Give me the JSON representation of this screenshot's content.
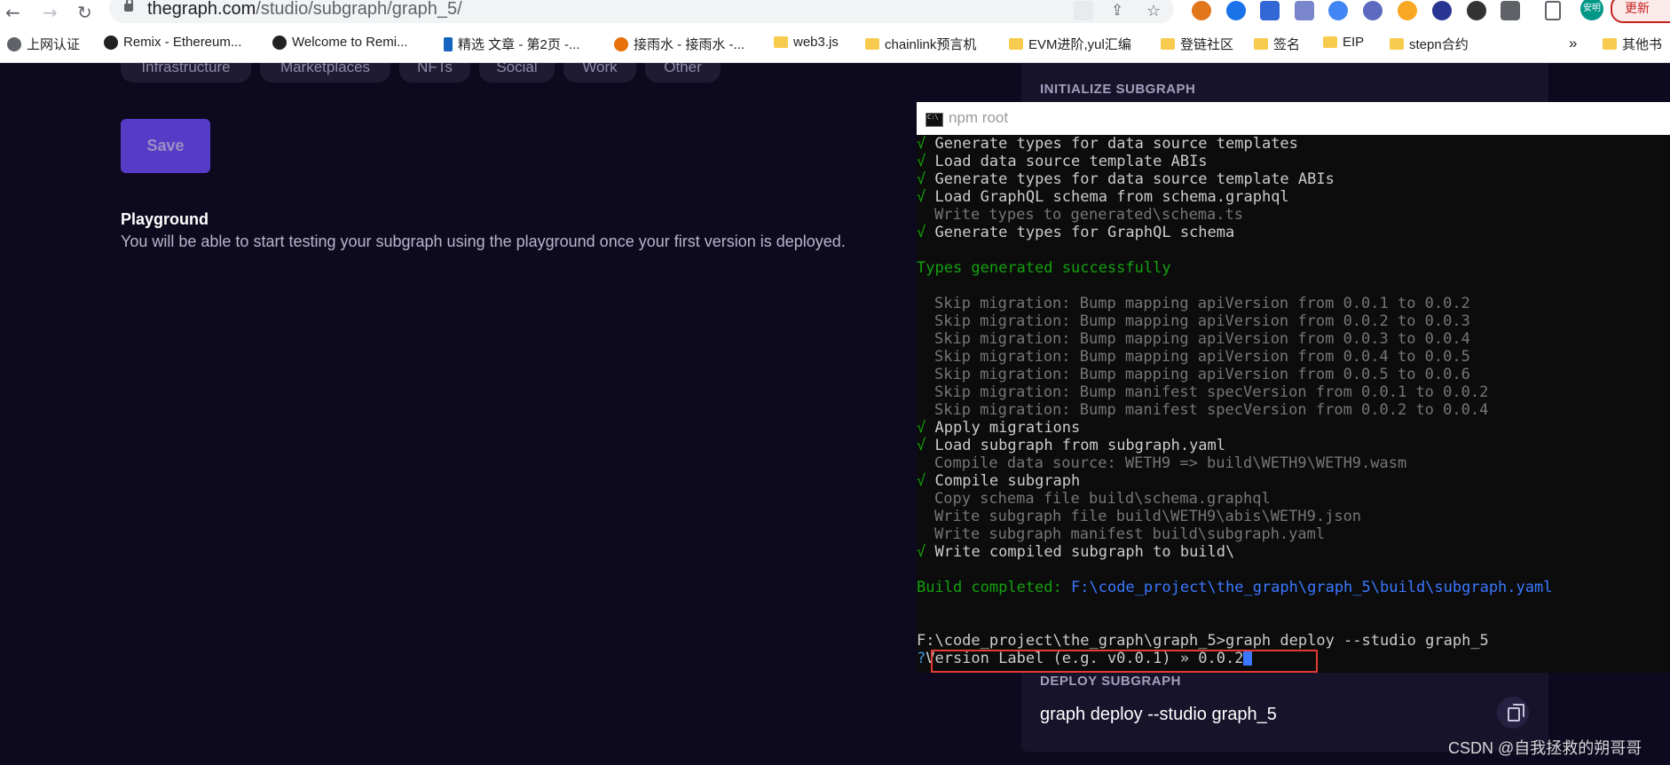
{
  "browser": {
    "url_host": "thegraph.com",
    "url_path": "/studio/subgraph/graph_5/",
    "update_label": "更新",
    "profile_label": "安明",
    "bookmarks": [
      "上网认证",
      "Remix - Ethereum...",
      "Welcome to Remi...",
      "精选 文章 - 第2页 -...",
      "接雨水 - 接雨水 -...",
      "web3.js",
      "chainlink预言机",
      "EVM进阶,yul汇编",
      "登链社区",
      "签名",
      "EIP",
      "stepn合约"
    ],
    "overflow_label": "»",
    "other_bookmarks": "其他书"
  },
  "page": {
    "categories": [
      "Infrastructure",
      "Marketplaces",
      "NFTs",
      "Social",
      "Work",
      "Other"
    ],
    "save_label": "Save",
    "playground_title": "Playground",
    "playground_desc": "You will be able to start testing your subgraph using the playground once your first version is deployed.",
    "init_label": "INITIALIZE SUBGRAPH",
    "deploy_label": "DEPLOY SUBGRAPH",
    "deploy_cmd": "graph deploy --studio graph_5"
  },
  "terminal": {
    "title": "npm root",
    "check": "√",
    "lines": {
      "l1": "Generate types for data source templates",
      "l2": "Load data source template ABIs",
      "l3": "Generate types for data source template ABIs",
      "l4": "Load GraphQL schema from schema.graphql",
      "l5": "Write types to generated\\schema.ts",
      "l6": "Generate types for GraphQL schema",
      "l7": "Types generated successfully",
      "m1": "Skip migration: Bump mapping apiVersion from 0.0.1 to 0.0.2",
      "m2": "Skip migration: Bump mapping apiVersion from 0.0.2 to 0.0.3",
      "m3": "Skip migration: Bump mapping apiVersion from 0.0.3 to 0.0.4",
      "m4": "Skip migration: Bump mapping apiVersion from 0.0.4 to 0.0.5",
      "m5": "Skip migration: Bump mapping apiVersion from 0.0.5 to 0.0.6",
      "m6": "Skip migration: Bump manifest specVersion from 0.0.1 to 0.0.2",
      "m7": "Skip migration: Bump manifest specVersion from 0.0.2 to 0.0.4",
      "a1": "Apply migrations",
      "a2": "Load subgraph from subgraph.yaml",
      "a3": "Compile data source: WETH9 => build\\WETH9\\WETH9.wasm",
      "a4": "Compile subgraph",
      "a5": "Copy schema file build\\schema.graphql",
      "a6": "Write subgraph file build\\WETH9\\abis\\WETH9.json",
      "a7": "Write subgraph manifest build\\subgraph.yaml",
      "a8": "Write compiled subgraph to build\\",
      "b1": "Build completed:",
      "b2": "F:\\code_project\\the_graph\\graph_5\\build\\subgraph.yaml",
      "c1": "F:\\code_project\\the_graph\\graph_5>graph deploy --studio graph_5",
      "q_mark": "?",
      "q_text": "Version Label (e.g. v0.0.1) » 0.0.2"
    }
  },
  "watermark": "CSDN @自我拯救的朔哥哥",
  "colors": {
    "page_bg": "#0d0a1f",
    "accent": "#6f4cff",
    "terminal_green": "#13a10e",
    "terminal_blue": "#3b78ff",
    "highlight_red": "#e53935"
  }
}
